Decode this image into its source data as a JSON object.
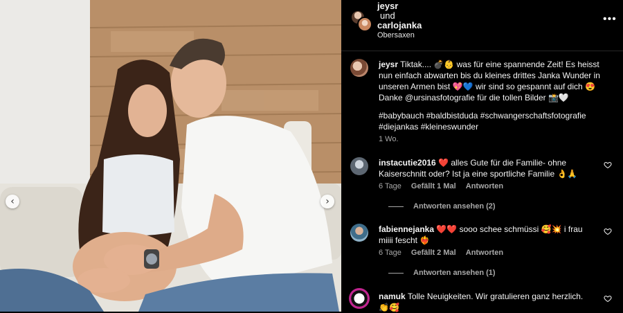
{
  "header": {
    "user1": "jeysr",
    "and_text": "und",
    "user2": "carlojanka",
    "location": "Obersaxen",
    "more_glyph": "•••"
  },
  "post": {
    "username": "jeysr",
    "caption": "Tiktak.... 💣👶 was für eine spannende Zeit! Es heisst nun einfach abwarten bis du kleines drittes Janka Wunder in unseren Armen bist 💖💙 wir sind so gespannt auf dich 😍 Danke @ursinasfotografie für die tollen Bilder 📸🤍",
    "hashtags": "#babybauch #baldbistduda #schwangerschaftsfotografie #diejankas #kleineswunder",
    "time": "1 Wo."
  },
  "comments": [
    {
      "username": "instacutie2016",
      "text": "❤️ alles Gute für die Familie- ohne Kaiserschnitt oder? Ist ja eine sportliche Familie 👌🙏",
      "time": "6 Tage",
      "likes": "Gefällt 1 Mal",
      "reply_label": "Antworten",
      "view_replies": "Antworten ansehen (2)"
    },
    {
      "username": "fabiennejanka",
      "text": "❤️❤️ sooo schee schmüssi 🥰💥 i frau miiii fescht ❤️‍🔥",
      "time": "6 Tage",
      "likes": "Gefällt 2 Mal",
      "reply_label": "Antworten",
      "view_replies": "Antworten ansehen (1)"
    },
    {
      "username": "namuk",
      "text": "Tolle Neuigkeiten. Wir gratulieren ganz herzlich. 👏🥰"
    }
  ],
  "photo": {
    "prev_glyph": "‹",
    "next_glyph": "›"
  },
  "icons": {
    "heart": "heart-outline-icon",
    "more": "more-options-icon",
    "prev": "chevron-left-icon",
    "next": "chevron-right-icon"
  }
}
